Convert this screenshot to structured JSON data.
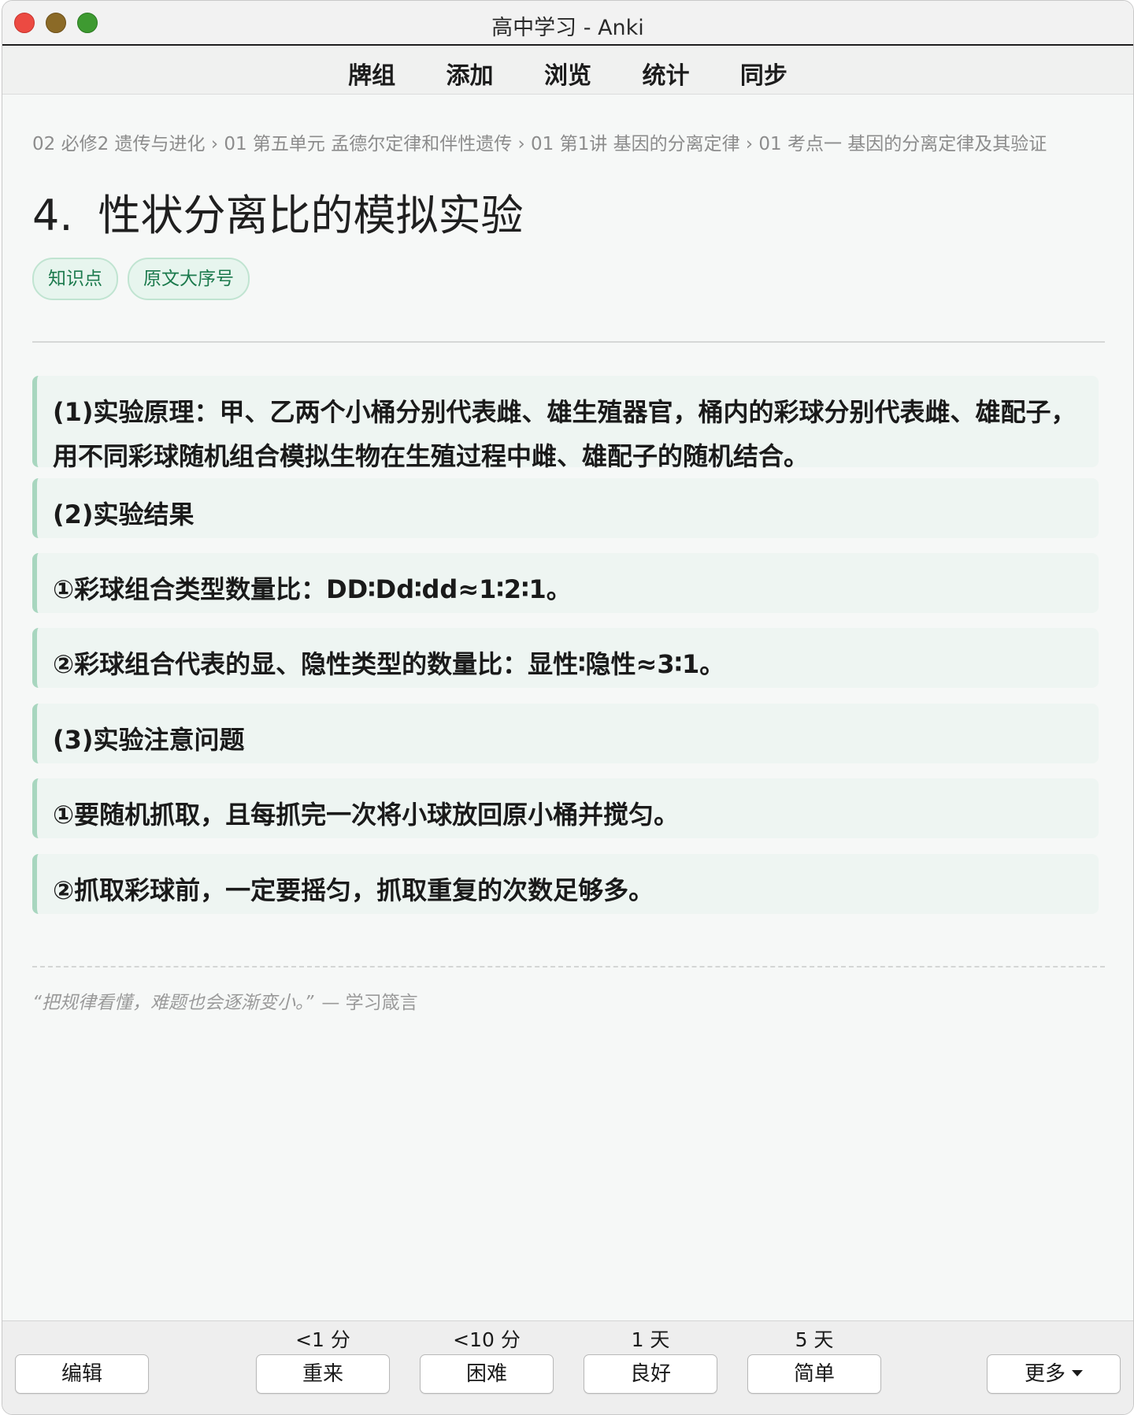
{
  "window": {
    "title": "高中学习 - Anki"
  },
  "menu": {
    "items": [
      "牌组",
      "添加",
      "浏览",
      "统计",
      "同步"
    ]
  },
  "card": {
    "breadcrumb": "02 必修2 遗传与进化 › 01 第五单元 孟德尔定律和伴性遗传 › 01 第1讲 基因的分离定律 › 01 考点一 基因的分离定律及其验证",
    "heading_number": "4.",
    "heading_text": "性状分离比的模拟实验",
    "tags": [
      "知识点",
      "原文大序号"
    ],
    "blocks": [
      "(1)实验原理：甲、乙两个小桶分别代表雌、雄生殖器官，桶内的彩球分别代表雌、雄配子，用不同彩球随机组合模拟生物在生殖过程中雌、雄配子的随机结合。",
      "(2)实验结果",
      "①彩球组合类型数量比：DD∶Dd∶dd≈1∶2∶1。",
      "②彩球组合代表的显、隐性类型的数量比：显性∶隐性≈3∶1。",
      "(3)实验注意问题",
      "①要随机抓取，且每抓完一次将小球放回原小桶并搅匀。",
      "②抓取彩球前，一定要摇匀，抓取重复的次数足够多。"
    ],
    "quote_text": "“把规律看懂，难题也会逐渐变小。”",
    "quote_source": "— 学习箴言"
  },
  "answer_bar": {
    "edit_label": "编辑",
    "more_label": "更多",
    "ease": [
      {
        "interval": "<1 分",
        "label": "重来"
      },
      {
        "interval": "<10 分",
        "label": "困难"
      },
      {
        "interval": "1 天",
        "label": "良好"
      },
      {
        "interval": "5 天",
        "label": "简单"
      }
    ]
  },
  "colors": {
    "accent_green": "#1c7a4d",
    "block_border": "#a8d6bf",
    "block_bg": "#eef5f2",
    "close": "#ec4a42",
    "minimize": "#8b6a27",
    "maximize": "#3e9a31"
  }
}
